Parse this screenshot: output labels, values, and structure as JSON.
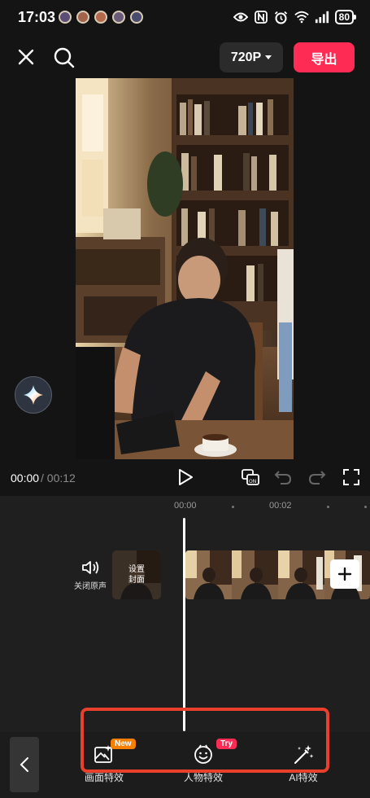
{
  "status_bar": {
    "time": "17:03",
    "battery": "80",
    "icons": [
      "eye-icon",
      "nfc-icon",
      "alarm-icon",
      "wifi-icon",
      "signal-icon",
      "battery-icon"
    ]
  },
  "top_bar": {
    "resolution": "720P",
    "export_label": "导出"
  },
  "playback": {
    "current_time": "00:00",
    "separator": "/",
    "total_time": "00:12"
  },
  "timeline": {
    "ruler_marks": [
      "00:00",
      "00:02"
    ],
    "mute_label": "关闭原声",
    "cover_label_line1": "设置",
    "cover_label_line2": "封面"
  },
  "bottom_tools": {
    "items": [
      {
        "label": "画面特效",
        "badge": "New",
        "icon": "image-effect-icon"
      },
      {
        "label": "人物特效",
        "badge": "Try",
        "icon": "face-effect-icon"
      },
      {
        "label": "AI特效",
        "badge": "",
        "icon": "magic-wand-icon"
      }
    ]
  },
  "colors": {
    "accent": "#fe2c55",
    "badge_new": "#f77f00",
    "highlight": "#e8402a",
    "background": "#141414"
  }
}
